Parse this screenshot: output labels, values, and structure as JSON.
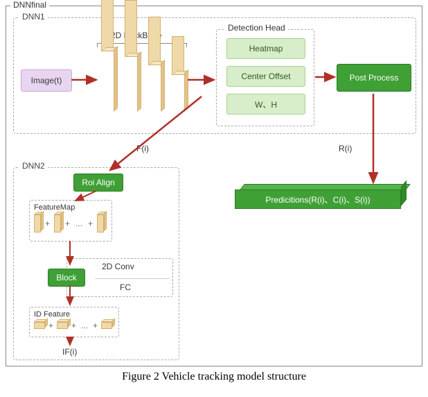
{
  "outer_title": "DNNfinal",
  "dnn1": {
    "title": "DNN1",
    "input": "Image(t)",
    "backbone_label": "2D BackBone",
    "detection_head": {
      "title": "Detection Head",
      "items": [
        "Heatmap",
        "Center Offset",
        "W、H"
      ]
    },
    "post_process": "Post Process"
  },
  "edges": {
    "fi": "F(i)",
    "ri": "R(i)"
  },
  "dnn2": {
    "title": "DNN2",
    "roi": "Roi Align",
    "feature_map": "FeatureMap",
    "block": "Block",
    "conv2d": "2D Conv",
    "fc": "FC",
    "id_feature": "ID Feature",
    "ifi": "IF(i)",
    "ellipsis": "..."
  },
  "predictions": "Predicitions(R(i)、C(i)、S(i))",
  "caption": "Figure 2 Vehicle tracking model structure"
}
